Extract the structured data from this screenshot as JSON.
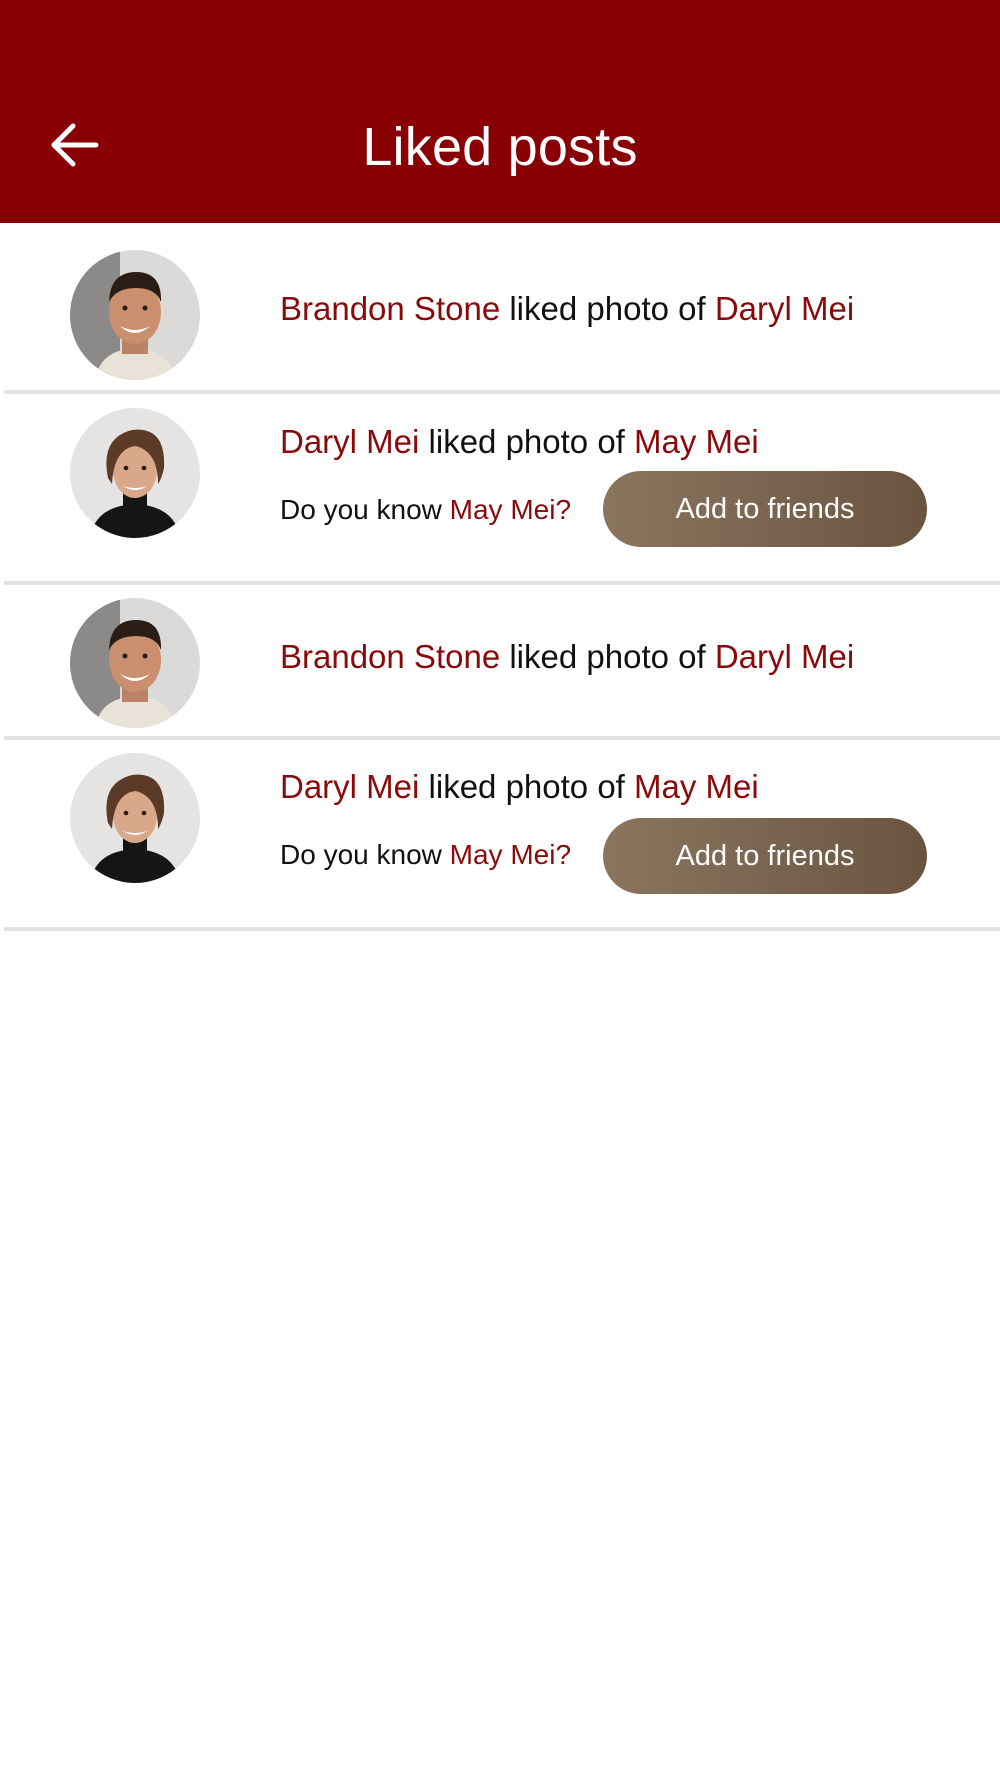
{
  "header": {
    "title": "Liked posts",
    "back_icon": "arrow-left-icon",
    "background": "#880003"
  },
  "feed": {
    "items": [
      {
        "avatar": "smiling-man-short-hair-avatar",
        "actor": "Brandon Stone",
        "action": "liked photo of",
        "target": "Daryl Mei"
      },
      {
        "avatar": "man-wavy-hair-turtleneck-avatar",
        "actor": "Daryl Mei",
        "action": "liked photo of",
        "target": "May Mei",
        "question_prefix": "Do you know",
        "question_name": "May Mei?",
        "add_label": "Add to friends"
      },
      {
        "avatar": "smiling-man-short-hair-avatar",
        "actor": "Brandon Stone",
        "action": "liked photo of",
        "target": "Daryl Mei"
      },
      {
        "avatar": "man-wavy-hair-turtleneck-avatar",
        "actor": "Daryl Mei",
        "action": "liked photo of",
        "target": "May Mei",
        "question_prefix": "Do you know",
        "question_name": "May Mei?",
        "add_label": "Add to friends"
      }
    ]
  },
  "colors": {
    "accent_name": "#8a0a0c",
    "button_gradient_start": "#8a765f",
    "button_gradient_end": "#6a543f",
    "divider": "#e3e3e3"
  }
}
